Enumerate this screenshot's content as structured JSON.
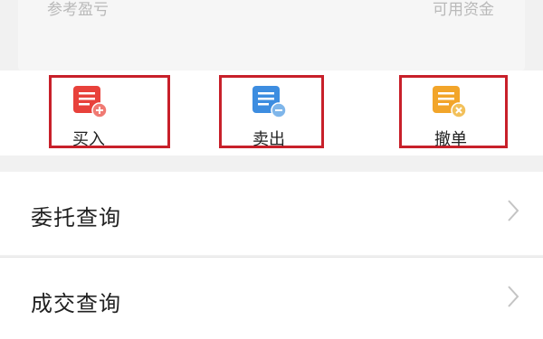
{
  "summary": {
    "left_label": "参考盈亏",
    "right_label": "可用资金"
  },
  "actions": [
    {
      "label": "买入",
      "color": "#e8413b",
      "badge": "#e8413b"
    },
    {
      "label": "卖出",
      "color": "#3d8de0",
      "badge": "#7fb6ea"
    },
    {
      "label": "撤单",
      "color": "#f2a52a",
      "badge": "#f2c05a"
    }
  ],
  "menu": [
    {
      "label": "委托查询"
    },
    {
      "label": "成交查询"
    }
  ]
}
